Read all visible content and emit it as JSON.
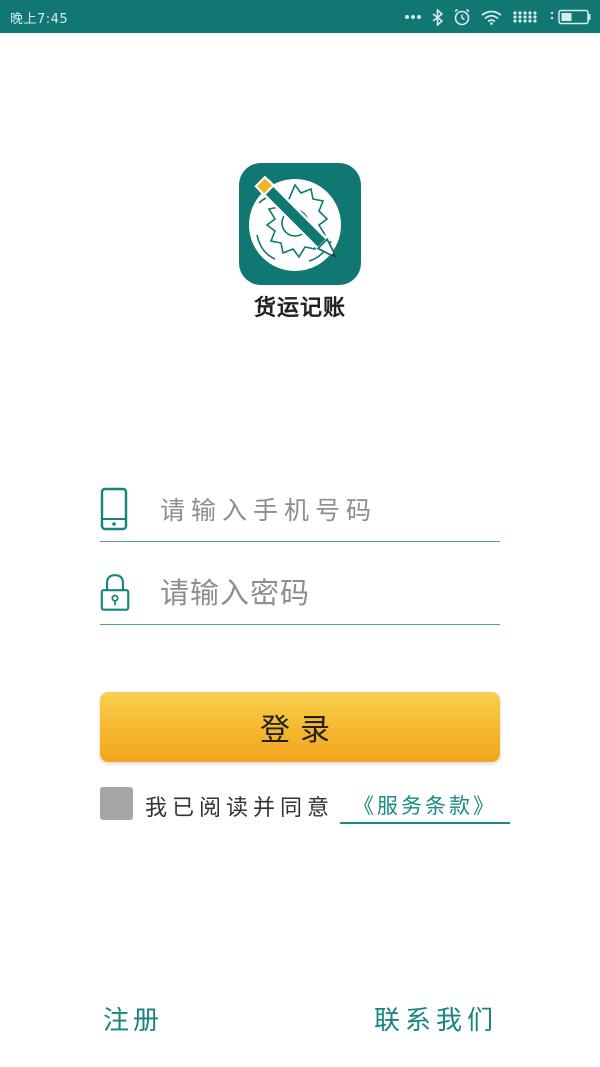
{
  "status_bar": {
    "time": "晚上7:45",
    "icons": [
      "more-dots-icon",
      "bluetooth-icon",
      "alarm-icon",
      "wifi-icon",
      "signal-icon",
      "battery-icon"
    ]
  },
  "app": {
    "name": "货运记账",
    "brand_color": "#107772"
  },
  "form": {
    "phone_placeholder": "请输入手机号码",
    "password_placeholder": "请输入密码",
    "login_label": "登录"
  },
  "agreement": {
    "text": "我已阅读并同意",
    "terms_link": "《服务条款》"
  },
  "footer": {
    "register_label": "注册",
    "contact_label": "联系我们"
  },
  "colors": {
    "status_bar": "#107772",
    "accent": "#168580",
    "button_top": "#f9cf4f",
    "button_bottom": "#f2a520",
    "checkbox": "#a6a6a6"
  }
}
